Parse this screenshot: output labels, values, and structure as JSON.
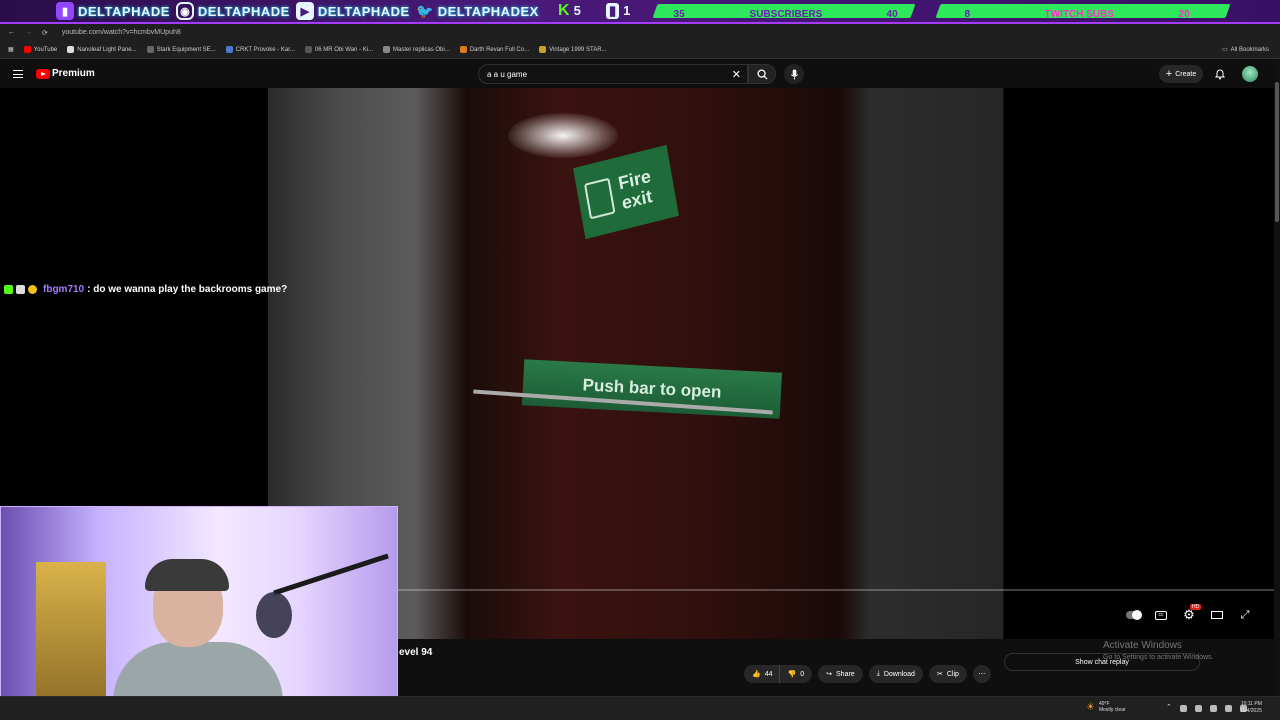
{
  "overlay": {
    "handles": [
      "DELTAPHADE",
      "DELTAPHADE",
      "DELTAPHADE",
      "DELTAPHADEX"
    ],
    "kick_count": "5",
    "twitch_count": "1",
    "subs_goal": {
      "start": "35",
      "label": "SUBSCRIBERS",
      "end": "40"
    },
    "twitch_subs_goal": {
      "start": "8",
      "label": "TWITCH SUBS",
      "end": "20"
    }
  },
  "browser": {
    "url": "youtube.com/watch?v=hcmbvMUpuh8",
    "bookmarks": [
      "YouTube",
      "Nanoleaf Light Pane...",
      "Stark Equipment SE...",
      "CRKT Provoke - Kar...",
      "06 MR Obi Wan - Ki...",
      "Master replicas Obi...",
      "Darth Revan Full Co...",
      "Vintage 1999 STAR..."
    ],
    "all_bookmarks": "All Bookmarks"
  },
  "youtube": {
    "brand": "Premium",
    "search_query": "a a u game",
    "create_label": "Create"
  },
  "chat": {
    "username": "fbgm710",
    "message": ": do we wanna play the backrooms game?"
  },
  "video": {
    "sign_line1": "Fire",
    "sign_line2": "exit",
    "push_bar": "Push bar to open",
    "title_fragment": "evel 94",
    "likes": "44",
    "dislikes": "0",
    "share_label": "Share",
    "download_label": "Download",
    "clip_label": "Clip",
    "chat_replay_label": "Show chat replay"
  },
  "player": {
    "hd_badge": "HD"
  },
  "windows": {
    "activate_title": "Activate Windows",
    "activate_sub": "Go to Settings to activate Windows."
  },
  "taskbar": {
    "temp": "49°F",
    "condition": "Mostly clear",
    "time": "10:11 PM",
    "date": "11/4/2025"
  }
}
